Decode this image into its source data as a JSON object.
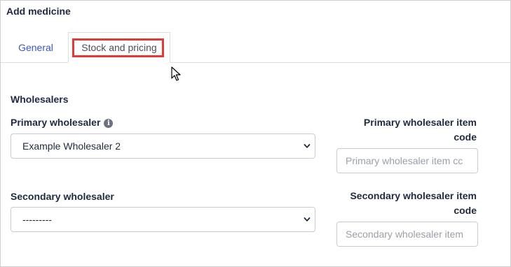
{
  "window": {
    "title": "Add medicine"
  },
  "tabs": [
    {
      "label": "General",
      "active": false
    },
    {
      "label": "Stock and pricing",
      "active": true
    }
  ],
  "section": {
    "heading": "Wholesalers"
  },
  "primary_wholesaler": {
    "label": "Primary wholesaler",
    "info_icon": "info-icon",
    "selected": "Example Wholesaler 2"
  },
  "primary_item_code": {
    "label_line1": "Primary wholesaler item",
    "label_line2": "code",
    "placeholder": "Primary wholesaler item cc"
  },
  "secondary_wholesaler": {
    "label": "Secondary wholesaler",
    "selected": "---------"
  },
  "secondary_item_code": {
    "label_line1": "Secondary wholesaler item",
    "label_line2": "code",
    "placeholder": "Secondary wholesaler item"
  },
  "colors": {
    "tab_link": "#3a57c4",
    "highlight": "#e53935",
    "text": "#1f2a3d"
  }
}
